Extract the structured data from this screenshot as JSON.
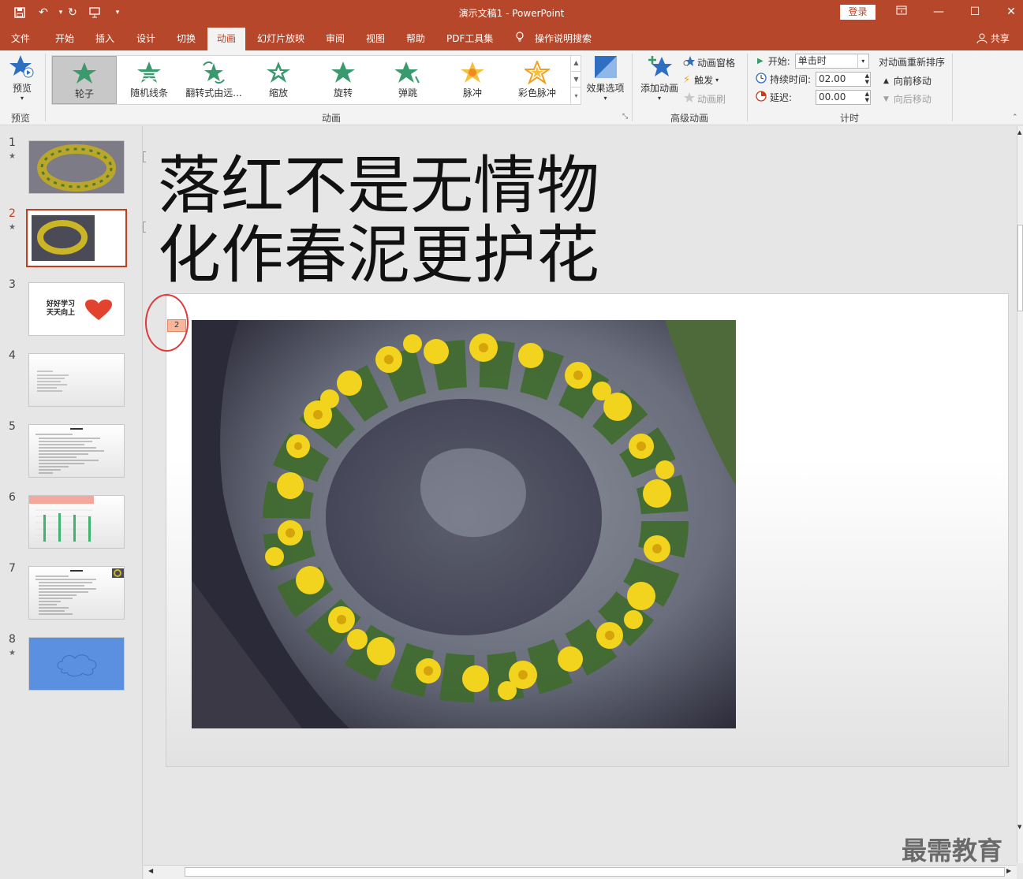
{
  "window": {
    "title": "演示文稿1  -  PowerPoint",
    "login_label": "登录",
    "share_label": "共享"
  },
  "tabs": [
    {
      "label": "文件"
    },
    {
      "label": "开始"
    },
    {
      "label": "插入"
    },
    {
      "label": "设计"
    },
    {
      "label": "切换"
    },
    {
      "label": "动画"
    },
    {
      "label": "幻灯片放映"
    },
    {
      "label": "审阅"
    },
    {
      "label": "视图"
    },
    {
      "label": "帮助"
    },
    {
      "label": "PDF工具集"
    },
    {
      "label": "操作说明搜索"
    }
  ],
  "ribbon": {
    "preview": {
      "button_label": "预览",
      "group_label": "预览"
    },
    "animation_group_label": "动画",
    "animations": [
      {
        "label": "轮子",
        "color": "#3a9a6e"
      },
      {
        "label": "随机线条",
        "color": "#3a9a6e"
      },
      {
        "label": "翻转式由远...",
        "color": "#3a9a6e"
      },
      {
        "label": "缩放",
        "color": "#3a9a6e"
      },
      {
        "label": "旋转",
        "color": "#3a9a6e"
      },
      {
        "label": "弹跳",
        "color": "#3a9a6e"
      },
      {
        "label": "脉冲",
        "color": "#f0a020"
      },
      {
        "label": "彩色脉冲",
        "color": "#f0a020"
      }
    ],
    "effect_options_label": "效果选项",
    "advanced": {
      "group_label": "高级动画",
      "add_animation_label": "添加动画",
      "pane_label": "动画窗格",
      "trigger_label": "触发",
      "painter_label": "动画刷"
    },
    "timing": {
      "group_label": "计时",
      "start_label": "开始:",
      "start_value": "单击时",
      "duration_label": "持续时间:",
      "duration_value": "02.00",
      "delay_label": "延迟:",
      "delay_value": "00.00",
      "reorder_label": "对动画重新排序",
      "move_earlier_label": "向前移动",
      "move_later_label": "向后移动"
    }
  },
  "slides": [
    {
      "number": "1",
      "star": "★"
    },
    {
      "number": "2",
      "star": "★"
    },
    {
      "number": "3",
      "star": "",
      "text": "好好学习\n天天向上"
    },
    {
      "number": "4",
      "star": ""
    },
    {
      "number": "5",
      "star": ""
    },
    {
      "number": "6",
      "star": ""
    },
    {
      "number": "7",
      "star": ""
    },
    {
      "number": "8",
      "star": "★"
    }
  ],
  "current_slide": {
    "title_line1": "落红不是无情物",
    "title_line2": "化作春泥更护花",
    "animation_badge": "2"
  },
  "watermark": "最需教育"
}
